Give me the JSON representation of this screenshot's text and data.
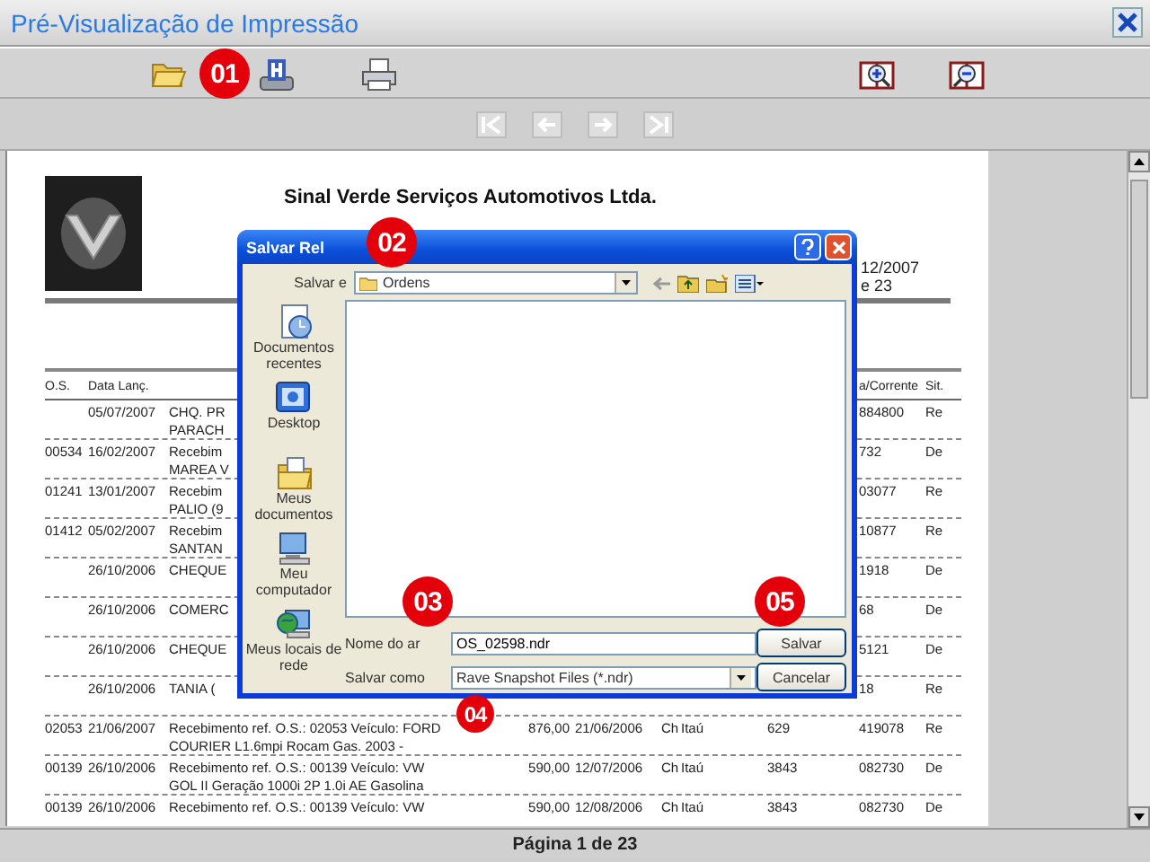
{
  "window": {
    "title": "Pré-Visualização de Impressão"
  },
  "report": {
    "company": "Sinal Verde Serviços Automotivos Ltda.",
    "header_right": [
      "12/2007",
      "e 23"
    ],
    "header": {
      "os": "O.S.",
      "date": "Data Lanç.",
      "account": "a/Corrente",
      "sit": "Sit."
    },
    "rows": [
      {
        "date": "05/07/2007",
        "desc": [
          "CHQ. PR",
          "PARACH"
        ],
        "account": "884800",
        "sit": "Re"
      },
      {
        "os": "00534",
        "date": "16/02/2007",
        "desc": [
          "Recebim",
          "MAREA V"
        ],
        "account": "732",
        "sit": "De"
      },
      {
        "os": "01241",
        "date": "13/01/2007",
        "desc": [
          "Recebim",
          "PALIO (9"
        ],
        "account": "03077",
        "sit": "Re"
      },
      {
        "os": "01412",
        "date": "05/02/2007",
        "desc": [
          "Recebim",
          "SANTAN"
        ],
        "account": "10877",
        "sit": "Re"
      },
      {
        "date": "26/10/2006",
        "desc": [
          "CHEQUE"
        ],
        "account": "1918",
        "sit": "De"
      },
      {
        "date": "26/10/2006",
        "desc": [
          "COMERC"
        ],
        "account": "68",
        "sit": "De"
      },
      {
        "date": "26/10/2006",
        "desc": [
          "CHEQUE"
        ],
        "account": "5121",
        "sit": "De"
      },
      {
        "date": "26/10/2006",
        "desc": [
          "TANIA ("
        ],
        "account": "18",
        "sit": "Re"
      },
      {
        "os": "02053",
        "date": "21/06/2007",
        "desc": [
          "Recebimento ref. O.S.: 02053 Veículo: FORD",
          "COURIER L1.6mpi Rocam Gas. 2003 -"
        ],
        "value": "876,00",
        "date2": "21/06/2006",
        "type": "Ch",
        "bank": "Itaú",
        "agency": "629",
        "account": "419078",
        "sit": "Re"
      },
      {
        "os": "00139",
        "date": "26/10/2006",
        "desc": [
          "Recebimento ref. O.S.: 00139 Veículo: VW",
          "GOL II Geração 1000i 2P 1.0i AE Gasolina"
        ],
        "value": "590,00",
        "date2": "12/07/2006",
        "type": "Ch",
        "bank": "Itaú",
        "agency": "3843",
        "account": "082730",
        "sit": "De"
      },
      {
        "os": "00139",
        "date": "26/10/2006",
        "desc": [
          "Recebimento ref. O.S.: 00139 Veículo: VW"
        ],
        "value": "590,00",
        "date2": "12/08/2006",
        "type": "Ch",
        "bank": "Itaú",
        "agency": "3843",
        "account": "082730",
        "sit": "De"
      }
    ]
  },
  "dialog": {
    "title": "Salvar Rel",
    "look_in_label": "Salvar e",
    "folder": "Ordens",
    "places": [
      "Documentos recentes",
      "Desktop",
      "Meus documentos",
      "Meu computador",
      "Meus locais de rede"
    ],
    "filename_label": "Nome do ar",
    "filename": "OS_02598.ndr",
    "filetype_label": "Salvar como",
    "filetype": "Rave Snapshot Files (*.ndr)",
    "buttons": [
      "Salvar",
      "Cancelar"
    ]
  },
  "status_bar": "Página 1 de 23",
  "badges": [
    "01",
    "02",
    "03",
    "04",
    "05"
  ]
}
